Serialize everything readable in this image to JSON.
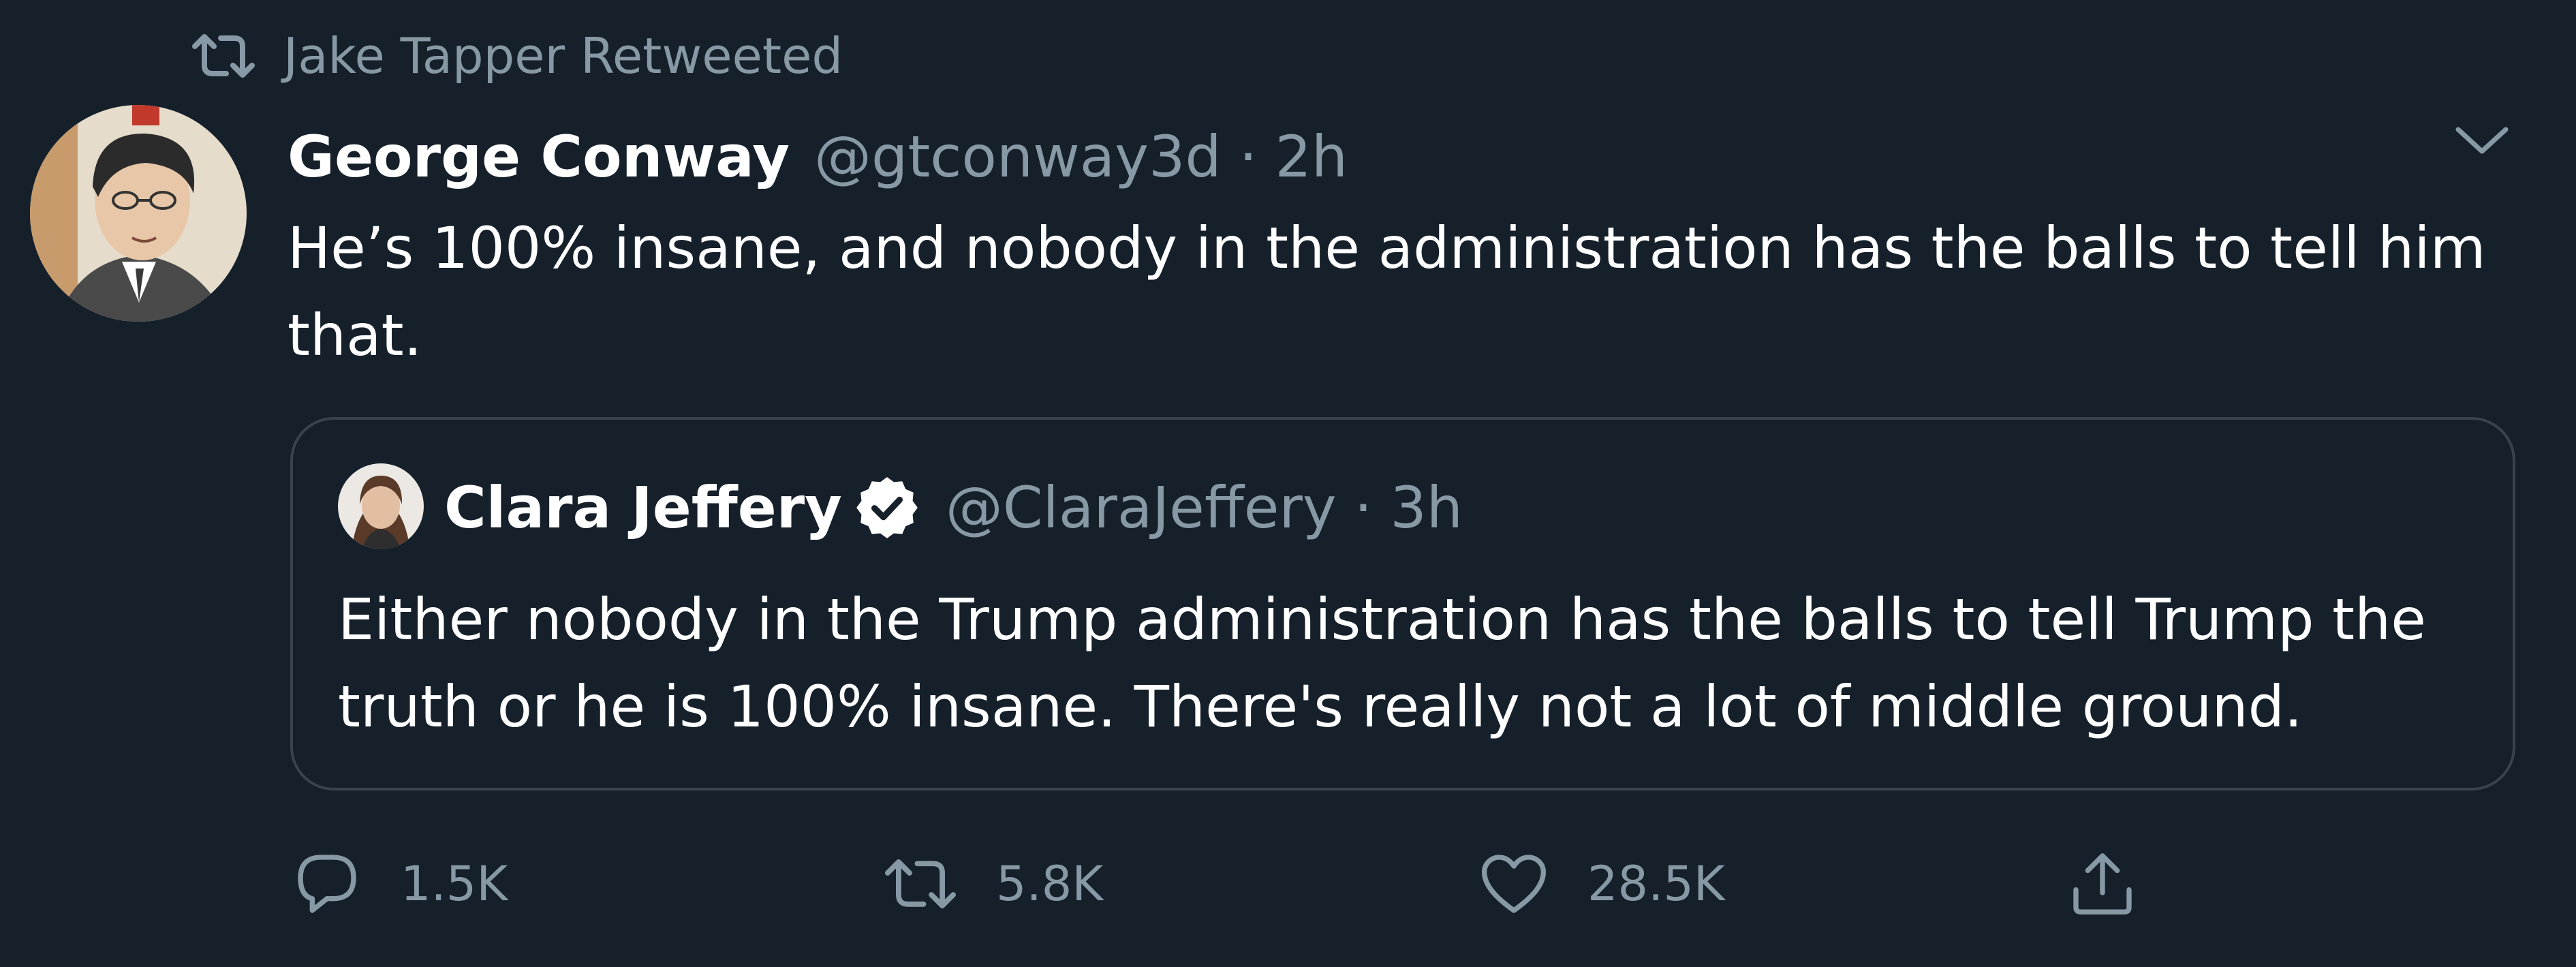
{
  "retweet_context": {
    "text": "Jake Tapper Retweeted",
    "icon": "retweet-icon"
  },
  "tweet": {
    "display_name": "George Conway",
    "handle": "@gtconway3d",
    "separator": "·",
    "time": "2h",
    "text": "He’s 100% insane, and nobody in the administration has the balls to tell him that.",
    "avatar": "avatar-sketch",
    "menu_icon": "chevron-down-icon"
  },
  "quoted_tweet": {
    "display_name": "Clara Jeffery",
    "verified": true,
    "verified_icon": "verified-badge-icon",
    "handle": "@ClaraJeffery",
    "separator": "·",
    "time": "3h",
    "text": "Either nobody in the Trump administration has the balls to tell Trump the truth or he is 100% insane. There's really not a lot of middle ground."
  },
  "actions": {
    "reply_count": "1.5K",
    "retweet_count": "5.8K",
    "like_count": "28.5K",
    "reply_icon": "reply-icon",
    "retweet_icon": "retweet-icon",
    "like_icon": "heart-icon",
    "share_icon": "share-icon"
  },
  "colors": {
    "background": "#15202b",
    "primary_text": "#ffffff",
    "secondary_text": "#8899a6",
    "border": "#38444d"
  }
}
